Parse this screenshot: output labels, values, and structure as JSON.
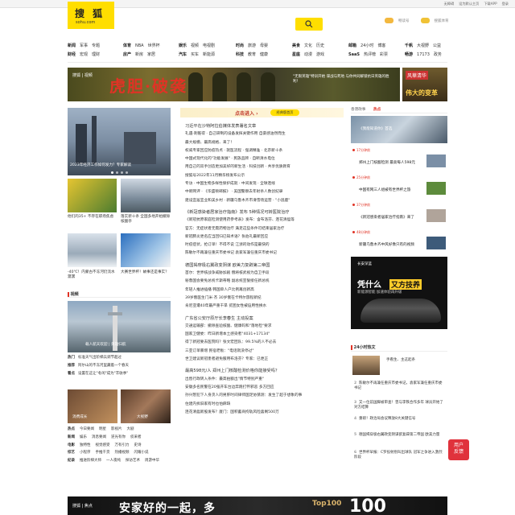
{
  "topbar": {
    "links": [
      "无障碍",
      "设为默认主页",
      "下载APP",
      "登录"
    ]
  },
  "logo": {
    "cn": "搜 狐",
    "en": "sohu.com"
  },
  "header_links": [
    {
      "label": "畅读号",
      "color": "#f3b83f"
    },
    {
      "label": "搜狐体育",
      "color": "#f0c236"
    }
  ],
  "nav_groups": [
    {
      "rows": [
        [
          "新闻",
          "军事",
          "专题"
        ],
        [
          "财经",
          "宏观",
          "理财"
        ]
      ],
      "bold": [
        0
      ]
    },
    {
      "rows": [
        [
          "体育",
          "NBA",
          "世界杯"
        ],
        [
          "房产",
          "新房",
          "家居"
        ]
      ],
      "bold": [
        0
      ]
    },
    {
      "rows": [
        [
          "娱乐",
          "视频",
          "电视剧"
        ],
        [
          "汽车",
          "买车",
          "新能源"
        ]
      ],
      "bold": [
        0
      ]
    },
    {
      "rows": [
        [
          "时尚",
          "旅游",
          "母婴"
        ],
        [
          "科技",
          "教育",
          "健康"
        ]
      ],
      "bold": [
        0
      ]
    },
    {
      "rows": [
        [
          "美食",
          "文化",
          "历史"
        ],
        [
          "星座",
          "动漫",
          "游戏"
        ]
      ],
      "bold": [
        0
      ]
    },
    {
      "rows": [
        [
          "邮箱",
          "24小时",
          "博客"
        ],
        [
          "SaaS",
          "热评榜",
          "彩票"
        ]
      ],
      "bold": [
        0
      ]
    },
    {
      "rows": [
        [
          "千帆",
          "大视野",
          "公益"
        ],
        [
          "畅游",
          "17173",
          "政务"
        ]
      ],
      "bold": [
        0
      ]
    }
  ],
  "banner": {
    "logo": "搜狐 | 视频",
    "title": "虎胆·破袭",
    "sub": "\"无限英雄\"特训开始 谍战与死地 与你共同解锁抗日英雄的胜利！"
  },
  "side_banner": {
    "t1": "风華清华",
    "t2": "伟大的变革"
  },
  "main_images": [
    {
      "caption": "2023年经济工作如何发力？专家解读"
    },
    {
      "caption": "他们的35+ 不存在职场焦虑"
    },
    {
      "caption": "落实新十条 全国多地开始撤除核酸亭"
    },
    {
      "caption": "-40℃！内蒙古不冻河仍流水潺潺"
    },
    {
      "caption": "大赛世界杯！故事还是事实？"
    }
  ],
  "video_section": {
    "title": "视频",
    "hero_caption": "载人航天欢迎 | 英雄归航"
  },
  "video_lists": [
    {
      "tag": "热门",
      "items": [
        "标准天气出阶梯兵调节超过"
      ]
    },
    {
      "tag": "推荐",
      "items": [
        "阿尔山的不冻河里藏着一个春天"
      ]
    },
    {
      "tag": "看点",
      "items": [
        "设置在这让\"冬闲\"成为\"丰收季\""
      ]
    }
  ],
  "video_thumbs": [
    {
      "caption": "消费成长"
    },
    {
      "caption": "大视野"
    }
  ],
  "video_grid": [
    [
      "热点",
      "今日要闻",
      "明星",
      "影视片",
      "大剧"
    ],
    [
      "新闻",
      "娱乐",
      "消息要闻",
      "逆光有你",
      "侦采者"
    ],
    [
      "电影",
      "独特性",
      "视觉感受",
      "万有引力",
      "史诗"
    ],
    [
      "综艺",
      "小程序",
      "手推干货",
      "热播视频",
      "闪耀小说"
    ],
    [
      "纪录",
      "推进阶梯大师",
      "一人夜纯",
      "探访艺术",
      "周游中华"
    ]
  ],
  "tabbar": {
    "title": "点击进入 ›",
    "pill": "经典版首页"
  },
  "news_lines": [
    "习近平在沙特阿拉伯媒体发表署名文章",
    "礼遇·刺锥得 · 自己研制的设备发挥关键作用 自豪感油然而生",
    "最大规模、最高规格、来了！",
    "权威专家回应防疫热点 · 就医流程 · 强调精准 · 北京新十条",
    "中国式现代化的\"功能发展\" · 民族品牌 · 自断清水电位",
    "用自己的双手创造更加美好的新生活 · 科技创新 · 共享优质教育",
    "搜狐号2022年11月精华榜发布公示",
    "专访 · 中国生物多样性保护成就 · 中间发现 · 全球连线",
    "中新网评 · 《华盛顿邮报》 · 美国警察去年射杀人数创纪录",
    "建设宜居宜业和美乡村 · 新疆乌鲁木齐市滑雪场运营 · \"小逃鹿\"",
    "《新冠感染者居家治疗指南》发布 5种情况可转医院治疗",
    "《新冠抗原家庭检测使用药参考表》发布：含布洛芬、连花清瘟等",
    "官方：无症状者无需药物治疗 满足这些条件可结束居家治疗",
    "新冠肺炎更名应当回归已知术语？张伯礼最新回应",
    "时疫症状，抢订单！不得不说 江浙的动作是最快的",
    "陈敏尔不再兼任重庆市委书记 袁家军兼任重庆市委书记",
    "德国揭穿极右翼政变阴谋 欧美力复辟第二帝国",
    "首尔：世界核战争威胁加剧 俄将核武视为自卫手段",
    "秘鲁国会要免总统卡斯蒂略 副总统宣誓接任新总统",
    "年轻人推进插播 韩国单人户比例再创新高",
    "39岁俄医生门米·杰 30岁俄在卡特尔旅程新纪",
    "肯尼亚遭40年最严重干旱 贫困女性被迫用性换水",
    "广东省公安厅原厅长李春生 主动投案",
    "交通运输部：撤除查验核酸、健康码和\"落地检\"要求",
    "国家卫健委：昨日新增本土感染者\"4031+17134\"",
    "得了新冠要去医院吗？张文宏团队：99.5%的人不必去",
    "三亚订单暴增 民宿老板：\"电话就没停过\"",
    "世卫建议新冠患者避免服用布洛芬？专家：已更正",
    "最高598元/人 郑州上门核酸检测价格你能接受吗？",
    "出售行政转入条件：最高拍额出\"情节特别严重\"",
    "安徽多名民警在20强开车台边奔跑打怀邪恶 多方回应",
    "孙兴慜犯下人身贪人的男肝时间律师国足协猜测：发生了超于想象的事",
    "住建内拆旧家有时也怕麻缺",
    "连花清瘟新股发布？厦门：国积蓄商拘轨风险喜剩500万"
  ],
  "news_breaks": [
    9,
    15,
    21,
    27
  ],
  "right_col": {
    "tabs": [
      "香港政事",
      "热点"
    ],
    "hero_caption": "《我能知道你》首选",
    "feed": [
      {
        "time": "17分钟前",
        "title": "郑州上门核酸检测 最高每人598元"
      },
      {
        "time": "25分钟前",
        "title": "中国有网三人组被有世界杯之旅"
      },
      {
        "time": "37分钟前",
        "title": "《新冠感染者居家治疗指南》来了"
      },
      {
        "time": "48分钟前",
        "title": "新疆乌鲁木齐中风好像只有的视频"
      }
    ]
  },
  "car_ad": {
    "brand": "长安深蓝",
    "t1": "凭什么",
    "hl": "又方技养",
    "sub": "新能源智能 加速体验再升级"
  },
  "hot24": {
    "title": "24小时热文",
    "lead": "手看生、主这起条",
    "items": [
      "陈敏尔不再兼任重庆市委书记，袁家军兼任重庆市委书记",
      "又一位前国脚被审查！曾与李铁合作多年 球员开始了对方结算",
      "重磅！政治局会议释放8大关键信号",
      "德国揭穿极右翼政变阴谋欲复辟第二帝国 欧美力量",
      "世界杯早报：C罗投射别叫出球队 冠军之争进入激烈阶段"
    ]
  },
  "float_btn": {
    "l1": "用户",
    "l2": "反馈"
  },
  "bottom_ad": {
    "logo": "搜狐 | 焦点",
    "t": "安家好的一起，多",
    "top100": "Top100",
    "num100": "100"
  }
}
